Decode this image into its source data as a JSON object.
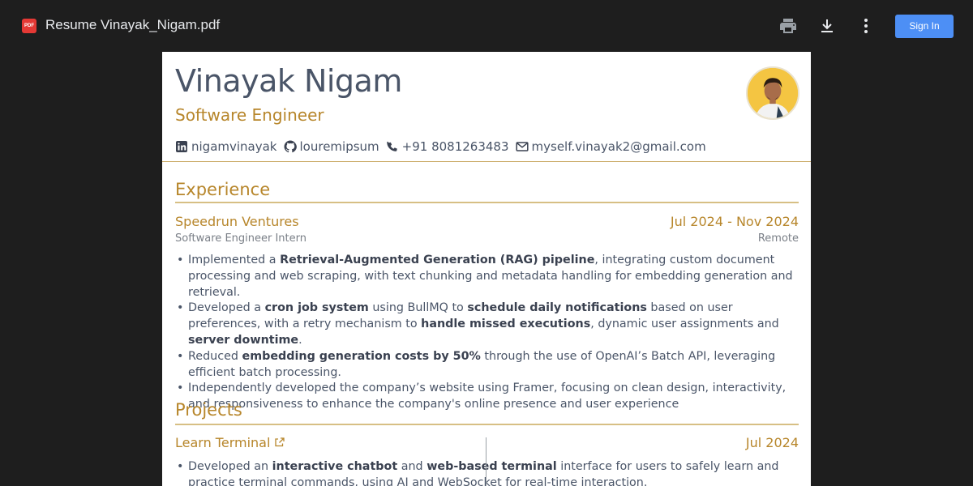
{
  "toolbar": {
    "file_icon_label": "PDF",
    "file_title": "Resume Vinayak_Nigam.pdf",
    "print_icon": "print-icon",
    "download_icon": "download-icon",
    "more_icon": "more-vert-icon",
    "sign_in_label": "Sign In"
  },
  "header": {
    "name": "Vinayak Nigam",
    "role": "Software Engineer",
    "contacts": [
      {
        "icon": "linkedin-icon",
        "text": "nigamvinayak"
      },
      {
        "icon": "github-icon",
        "text": "louremipsum"
      },
      {
        "icon": "phone-icon",
        "text": "+91 8081263483"
      },
      {
        "icon": "mail-icon",
        "text": "myself.vinayak2@gmail.com"
      }
    ]
  },
  "experience": {
    "title": "Experience",
    "company": "Speedrun Ventures",
    "dates": "Jul 2024 - Nov 2024",
    "position": "Software Engineer Intern",
    "location": "Remote",
    "bullets": [
      [
        {
          "t": "Implemented a ",
          "b": false
        },
        {
          "t": "Retrieval-Augmented Generation (RAG) pipeline",
          "b": true
        },
        {
          "t": ", integrating custom document processing and web scraping, with text chunking and metadata handling for embedding generation and retrieval.",
          "b": false
        }
      ],
      [
        {
          "t": "Developed a ",
          "b": false
        },
        {
          "t": "cron job system",
          "b": true
        },
        {
          "t": " using BullMQ to ",
          "b": false
        },
        {
          "t": "schedule daily notifications",
          "b": true
        },
        {
          "t": " based on user preferences, with a retry mechanism to ",
          "b": false
        },
        {
          "t": "handle missed executions",
          "b": true
        },
        {
          "t": ", dynamic user assignments and ",
          "b": false
        },
        {
          "t": "server downtime",
          "b": true
        },
        {
          "t": ".",
          "b": false
        }
      ],
      [
        {
          "t": "Reduced ",
          "b": false
        },
        {
          "t": "embedding generation costs by 50%",
          "b": true
        },
        {
          "t": " through the use of OpenAI’s Batch API, leveraging efficient batch processing.",
          "b": false
        }
      ],
      [
        {
          "t": "Independently developed the company’s website using Framer, focusing on clean design, interactivity, and responsiveness to enhance the company's online presence and user experience",
          "b": false
        }
      ]
    ]
  },
  "projects": {
    "title": "Projects",
    "project_name": "Learn Terminal",
    "project_date": "Jul 2024",
    "link_icon": "external-link-icon",
    "bullets": [
      [
        {
          "t": "Developed an ",
          "b": false
        },
        {
          "t": "interactive chatbot",
          "b": true
        },
        {
          "t": " and ",
          "b": false
        },
        {
          "t": "web-based terminal",
          "b": true
        },
        {
          "t": " interface for users to safely learn and practice terminal commands, using AI and WebSocket for real-time interaction.",
          "b": false
        }
      ]
    ]
  },
  "colors": {
    "accent": "#b7862b",
    "text": "#4a5568",
    "toolbar_bg": "#1e1e1e",
    "sign_in_bg": "#4d8ff5"
  }
}
